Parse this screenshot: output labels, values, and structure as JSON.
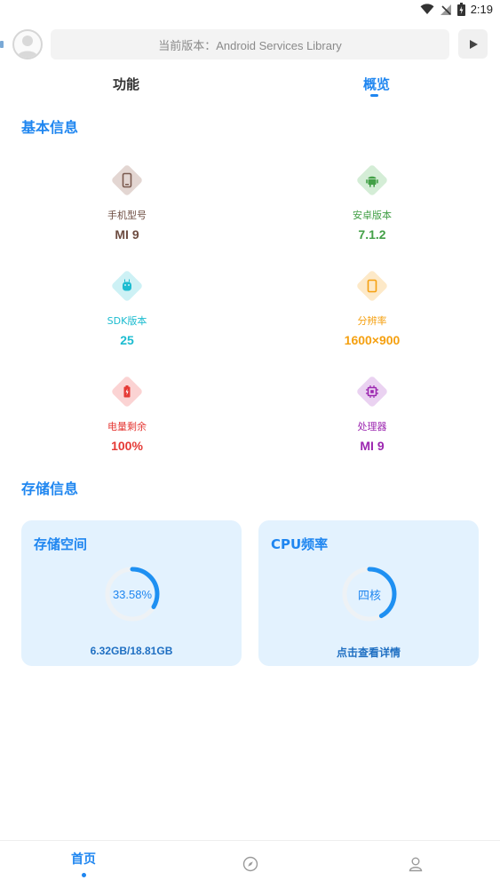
{
  "status_bar": {
    "time": "2:19"
  },
  "header": {
    "version_text": "当前版本：Android Services Library"
  },
  "tabs": [
    {
      "label": "功能"
    },
    {
      "label": "概览"
    }
  ],
  "basic_info": {
    "title": "基本信息",
    "items": [
      {
        "label": "手机型号",
        "value": "MI 9",
        "icon": "phone-icon",
        "color": "#7b5a4f",
        "bg": "#e3d6d2"
      },
      {
        "label": "安卓版本",
        "value": "7.1.2",
        "icon": "android-icon",
        "color": "#43a047",
        "bg": "#d4edd6"
      },
      {
        "label": "SDK版本",
        "value": "25",
        "icon": "android-bot-icon",
        "color": "#1cbcd0",
        "bg": "#cdf1f5"
      },
      {
        "label": "分辨率",
        "value": "1600×900",
        "icon": "screen-icon",
        "color": "#f5a010",
        "bg": "#fde9c8"
      },
      {
        "label": "电量剩余",
        "value": "100%",
        "icon": "battery-icon",
        "color": "#e53935",
        "bg": "#fbd3d3"
      },
      {
        "label": "处理器",
        "value": "MI 9",
        "icon": "chip-icon",
        "color": "#9c27b0",
        "bg": "#ead2f1"
      }
    ]
  },
  "storage_info": {
    "title": "存储信息",
    "storage_card": {
      "title": "存储空间",
      "percent_text": "33.58%",
      "fraction": 0.3358,
      "usage": "6.32GB/18.81GB"
    },
    "cpu_card": {
      "title": "CPU频率",
      "center_text": "四核",
      "fraction": 0.42,
      "link": "点击查看详情"
    }
  },
  "bottom_nav": {
    "home_label": "首页"
  }
}
